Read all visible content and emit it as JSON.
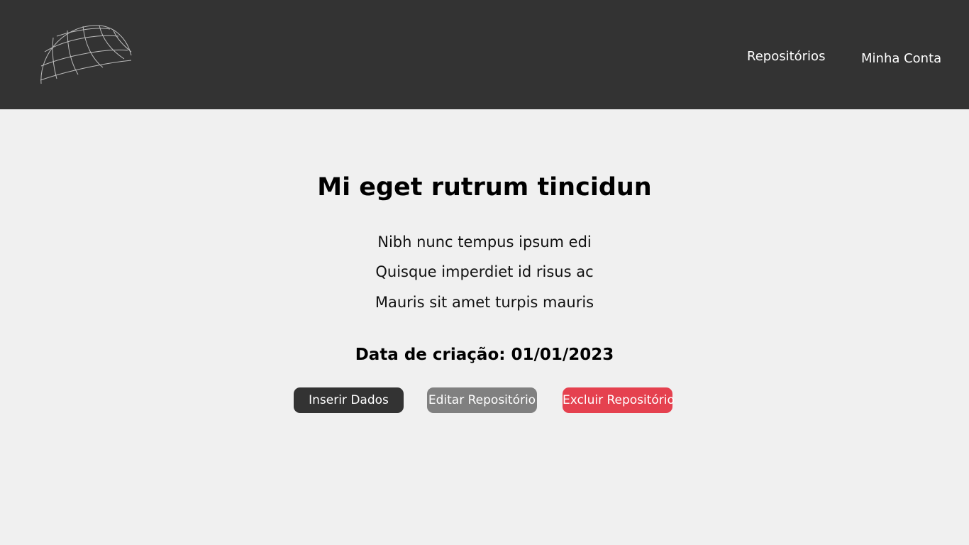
{
  "header": {
    "logo_icon": "globe-icon",
    "nav": {
      "repositories_label": "Repositórios",
      "account_label": "Minha Conta"
    }
  },
  "main": {
    "title": "Mi eget rutrum tincidun",
    "description_lines": [
      "Nibh nunc tempus ipsum edi",
      "Quisque imperdiet id risus ac",
      "Mauris sit amet turpis mauris"
    ],
    "created_date": "Data de criação: 01/01/2023",
    "buttons": {
      "insert_label": "Inserir Dados",
      "edit_label": "Editar Repositório",
      "delete_label": "Excluir Repositório"
    }
  },
  "colors": {
    "header_bg": "#333333",
    "page_bg": "#f0f0f0",
    "insert_bg": "#333333",
    "edit_bg": "#808080",
    "delete_bg": "#e5414f"
  }
}
